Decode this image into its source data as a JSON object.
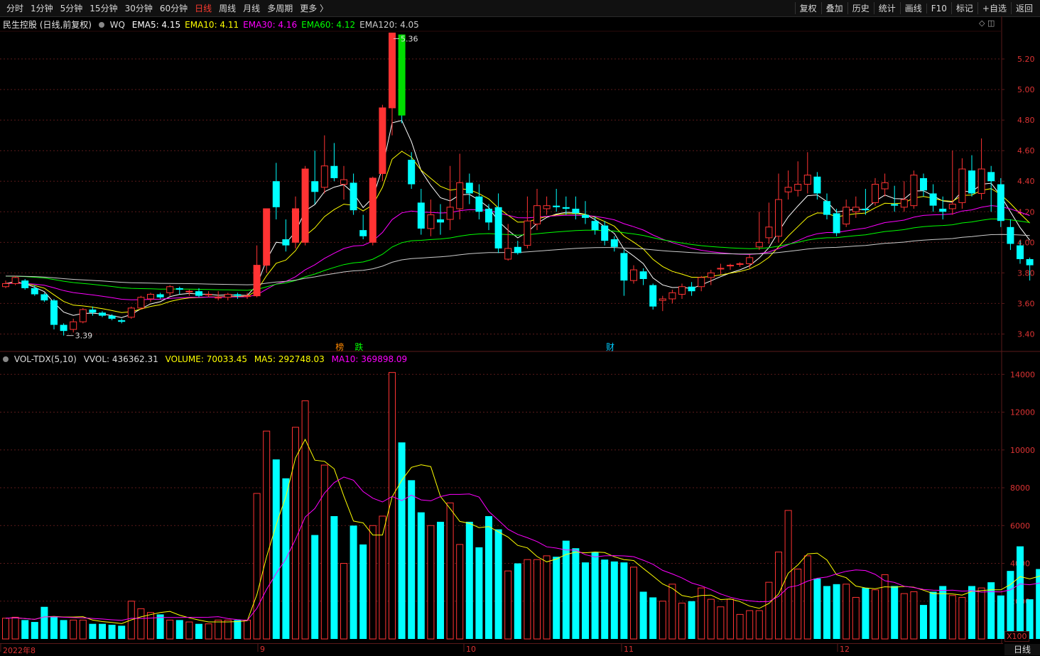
{
  "toolbar": {
    "periods": [
      "分时",
      "1分钟",
      "5分钟",
      "15分钟",
      "30分钟",
      "60分钟",
      "日线",
      "周线",
      "月线",
      "多周期",
      "更多 〉"
    ],
    "active_period": "日线",
    "right_buttons": [
      "复权",
      "叠加",
      "历史",
      "统计",
      "画线",
      "F10",
      "标记",
      "+自选",
      "返回"
    ]
  },
  "price_panel": {
    "title": "民生控股 (日线,前复权)",
    "indicator_name": "WQ",
    "ema": [
      {
        "label": "EMA5: 4.15",
        "color": "#ffffff"
      },
      {
        "label": "EMA10: 4.11",
        "color": "#ffff00"
      },
      {
        "label": "EMA30: 4.16",
        "color": "#ff00ff"
      },
      {
        "label": "EMA60: 4.12",
        "color": "#00ff00"
      },
      {
        "label": "EMA120: 4.05",
        "color": "#cccccc"
      }
    ],
    "y_ticks": [
      "5.20",
      "5.00",
      "4.80",
      "4.60",
      "4.40",
      "4.20",
      "4.00",
      "3.80",
      "3.60",
      "3.40"
    ],
    "high_label": "5.36",
    "low_label": "3.39",
    "markers": [
      {
        "text": "榜",
        "color": "#ff8800"
      },
      {
        "text": "跌",
        "color": "#00ff00"
      },
      {
        "text": "财",
        "color": "#00ccff"
      }
    ],
    "panel_controls": "◇ ◫"
  },
  "volume_panel": {
    "indicator": "VOL-TDX(5,10)",
    "vvol": "VVOL: 436362.31",
    "volume": "VOLUME: 70033.45",
    "ma5": "MA5: 292748.03",
    "ma10": "MA10: 369898.09",
    "y_ticks": [
      "14000",
      "12000",
      "10000",
      "8000",
      "6000",
      "4000",
      "2000"
    ],
    "unit": "X100"
  },
  "date_axis": [
    "2022年8",
    "9",
    "10",
    "11",
    "12"
  ],
  "bottom_right_label": "日线",
  "colors": {
    "up": "#ff3333",
    "down": "#00ffff",
    "grid": "#5a1a1a",
    "axis_text": "#dd3333"
  },
  "chart_data": {
    "type": "candlestick",
    "candles": [
      [
        3.71,
        3.73,
        3.7,
        3.75
      ],
      [
        3.73,
        3.77,
        3.72,
        3.78
      ],
      [
        3.75,
        3.7,
        3.69,
        3.76
      ],
      [
        3.7,
        3.66,
        3.65,
        3.72
      ],
      [
        3.66,
        3.62,
        3.61,
        3.67
      ],
      [
        3.62,
        3.46,
        3.43,
        3.63
      ],
      [
        3.46,
        3.42,
        3.39,
        3.47
      ],
      [
        3.43,
        3.48,
        3.41,
        3.5
      ],
      [
        3.48,
        3.56,
        3.47,
        3.57
      ],
      [
        3.56,
        3.54,
        3.52,
        3.58
      ],
      [
        3.54,
        3.52,
        3.51,
        3.55
      ],
      [
        3.52,
        3.5,
        3.49,
        3.53
      ],
      [
        3.49,
        3.48,
        3.47,
        3.5
      ],
      [
        3.51,
        3.57,
        3.5,
        3.58
      ],
      [
        3.57,
        3.64,
        3.56,
        3.65
      ],
      [
        3.63,
        3.66,
        3.61,
        3.67
      ],
      [
        3.66,
        3.64,
        3.63,
        3.67
      ],
      [
        3.67,
        3.71,
        3.65,
        3.72
      ],
      [
        3.7,
        3.69,
        3.66,
        3.71
      ],
      [
        3.68,
        3.68,
        3.65,
        3.69
      ],
      [
        3.68,
        3.65,
        3.64,
        3.7
      ],
      [
        3.66,
        3.66,
        3.64,
        3.68
      ],
      [
        3.64,
        3.64,
        3.62,
        3.68
      ],
      [
        3.64,
        3.66,
        3.62,
        3.67
      ],
      [
        3.66,
        3.65,
        3.63,
        3.67
      ],
      [
        3.65,
        3.65,
        3.63,
        3.67
      ],
      [
        3.65,
        3.85,
        3.64,
        3.98
      ],
      [
        3.85,
        4.22,
        3.8,
        4.22
      ],
      [
        4.4,
        4.23,
        4.15,
        4.52
      ],
      [
        4.02,
        3.98,
        3.94,
        4.15
      ],
      [
        4.0,
        4.22,
        3.96,
        4.3
      ],
      [
        4.0,
        4.48,
        3.98,
        4.5
      ],
      [
        4.4,
        4.33,
        4.25,
        4.6
      ],
      [
        4.36,
        4.5,
        4.32,
        4.7
      ],
      [
        4.5,
        4.42,
        4.4,
        4.65
      ],
      [
        4.38,
        4.41,
        4.28,
        4.5
      ],
      [
        4.39,
        4.21,
        4.18,
        4.45
      ],
      [
        4.08,
        4.04,
        4.02,
        4.18
      ],
      [
        4.0,
        4.42,
        3.98,
        4.43
      ],
      [
        4.45,
        4.88,
        4.4,
        4.9
      ],
      [
        4.88,
        5.37,
        4.7,
        5.37
      ],
      [
        5.36,
        4.83,
        4.78,
        5.36
      ],
      [
        4.54,
        4.38,
        4.35,
        4.59
      ],
      [
        4.26,
        4.09,
        4.05,
        4.35
      ],
      [
        4.09,
        4.18,
        4.04,
        4.28
      ],
      [
        4.15,
        4.13,
        4.05,
        4.25
      ],
      [
        4.15,
        4.23,
        4.08,
        4.5
      ],
      [
        4.22,
        4.39,
        4.15,
        4.58
      ],
      [
        4.39,
        4.32,
        4.25,
        4.45
      ],
      [
        4.3,
        4.2,
        4.15,
        4.38
      ],
      [
        4.22,
        4.13,
        4.08,
        4.25
      ],
      [
        4.23,
        3.96,
        3.93,
        4.32
      ],
      [
        3.89,
        3.96,
        3.88,
        4.12
      ],
      [
        3.97,
        3.93,
        3.92,
        4.01
      ],
      [
        3.98,
        4.14,
        3.96,
        4.3
      ],
      [
        4.12,
        4.24,
        4.08,
        4.35
      ],
      [
        4.22,
        4.24,
        4.18,
        4.3
      ],
      [
        4.24,
        4.23,
        4.2,
        4.35
      ],
      [
        4.23,
        4.22,
        4.18,
        4.3
      ],
      [
        4.22,
        4.19,
        4.15,
        4.3
      ],
      [
        4.18,
        4.16,
        4.12,
        4.27
      ],
      [
        4.14,
        4.08,
        4.05,
        4.17
      ],
      [
        4.11,
        4.01,
        3.98,
        4.14
      ],
      [
        4.02,
        3.97,
        3.94,
        4.04
      ],
      [
        3.93,
        3.75,
        3.65,
        3.95
      ],
      [
        3.75,
        3.82,
        3.73,
        3.85
      ],
      [
        3.81,
        3.76,
        3.72,
        3.83
      ],
      [
        3.72,
        3.58,
        3.56,
        3.73
      ],
      [
        3.62,
        3.63,
        3.55,
        3.65
      ],
      [
        3.63,
        3.67,
        3.6,
        3.69
      ],
      [
        3.66,
        3.71,
        3.63,
        3.73
      ],
      [
        3.71,
        3.68,
        3.65,
        3.74
      ],
      [
        3.71,
        3.77,
        3.68,
        3.78
      ],
      [
        3.77,
        3.8,
        3.72,
        3.82
      ],
      [
        3.83,
        3.83,
        3.79,
        3.86
      ],
      [
        3.85,
        3.85,
        3.82,
        3.86
      ],
      [
        3.86,
        3.86,
        3.84,
        3.87
      ],
      [
        3.86,
        3.9,
        3.83,
        3.92
      ],
      [
        3.97,
        4.0,
        3.95,
        4.2
      ],
      [
        4.03,
        4.1,
        3.99,
        4.26
      ],
      [
        4.04,
        4.28,
        4.0,
        4.45
      ],
      [
        4.33,
        4.36,
        4.28,
        4.47
      ],
      [
        4.34,
        4.38,
        4.3,
        4.53
      ],
      [
        4.38,
        4.44,
        4.32,
        4.59
      ],
      [
        4.43,
        4.32,
        4.28,
        4.46
      ],
      [
        4.27,
        4.18,
        4.15,
        4.32
      ],
      [
        4.19,
        4.06,
        4.04,
        4.22
      ],
      [
        4.12,
        4.23,
        4.1,
        4.28
      ],
      [
        4.2,
        4.23,
        4.16,
        4.3
      ],
      [
        4.22,
        4.21,
        4.18,
        4.35
      ],
      [
        4.26,
        4.38,
        4.24,
        4.42
      ],
      [
        4.35,
        4.39,
        4.3,
        4.45
      ],
      [
        4.25,
        4.24,
        4.2,
        4.37
      ],
      [
        4.23,
        4.28,
        4.2,
        4.4
      ],
      [
        4.24,
        4.44,
        4.22,
        4.47
      ],
      [
        4.42,
        4.34,
        4.3,
        4.45
      ],
      [
        4.32,
        4.24,
        4.2,
        4.38
      ],
      [
        4.22,
        4.2,
        4.15,
        4.3
      ],
      [
        4.22,
        4.25,
        4.18,
        4.6
      ],
      [
        4.26,
        4.48,
        4.22,
        4.55
      ],
      [
        4.47,
        4.32,
        4.3,
        4.57
      ],
      [
        4.32,
        4.48,
        4.28,
        4.68
      ],
      [
        4.46,
        4.4,
        4.2,
        4.5
      ],
      [
        4.38,
        4.14,
        4.1,
        4.42
      ],
      [
        4.1,
        3.99,
        3.95,
        4.15
      ],
      [
        3.98,
        3.89,
        3.86,
        4.01
      ],
      [
        3.89,
        3.85,
        3.75,
        3.9
      ]
    ],
    "volume_x100": [
      1100,
      1150,
      1000,
      900,
      1700,
      1200,
      1000,
      1000,
      1000,
      800,
      800,
      750,
      700,
      2000,
      1600,
      1400,
      1300,
      1000,
      1000,
      900,
      800,
      800,
      1000,
      1000,
      1000,
      1000,
      7700,
      11000,
      9500,
      8500,
      11200,
      12600,
      5500,
      9200,
      6500,
      4000,
      6000,
      5000,
      6000,
      6500,
      14100,
      10400,
      8400,
      6700,
      6000,
      6200,
      7200,
      5000,
      6200,
      4850,
      6500,
      5800,
      3600,
      4000,
      4200,
      4200,
      4400,
      4350,
      5200,
      4800,
      4050,
      4600,
      4200,
      4100,
      4050,
      3800,
      2500,
      2200,
      2000,
      2900,
      1900,
      2000,
      2700,
      2100,
      1700,
      2100,
      1300,
      1500,
      1500,
      3000,
      4600,
      6800,
      3700,
      4400,
      3200,
      2800,
      2900,
      2900,
      2200,
      2700,
      2600,
      3400,
      2800,
      2400,
      2500,
      1800,
      2500,
      2800,
      2300,
      2200,
      2800,
      2700,
      3000,
      2300,
      3600,
      4900,
      2100,
      3700,
      3500,
      4000
    ],
    "y_range_price": [
      3.3,
      5.4
    ],
    "y_range_volume_x100": [
      0,
      14500
    ],
    "x_month_labels": [
      "2022年8",
      "9",
      "10",
      "11",
      "12"
    ]
  }
}
